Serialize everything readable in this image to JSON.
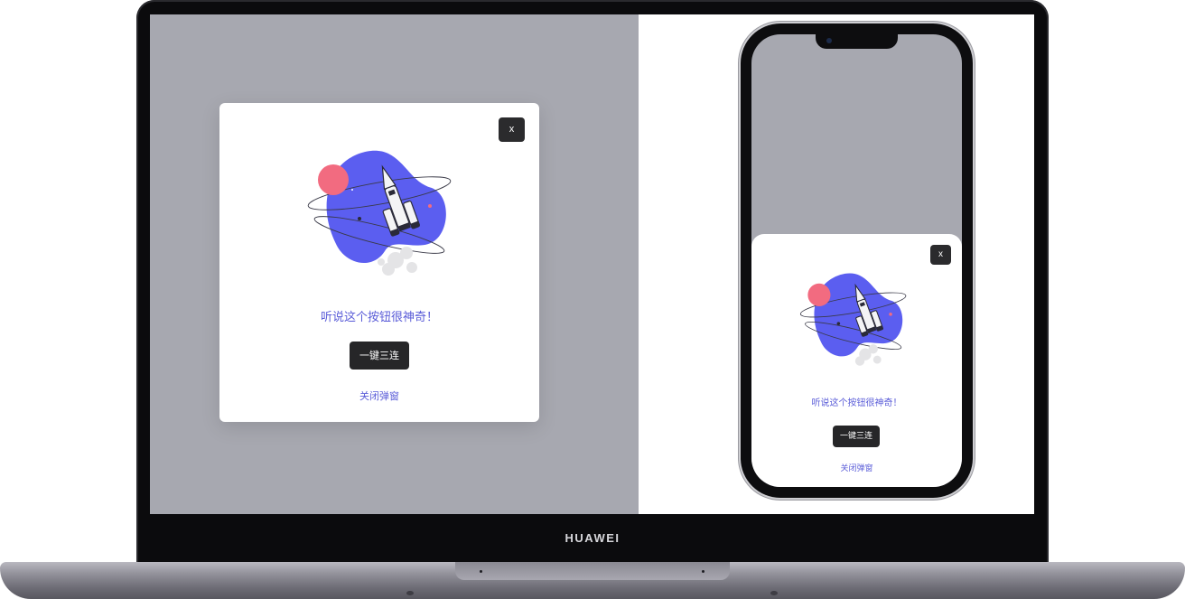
{
  "brand": "HUAWEI",
  "desktop_modal": {
    "close_label": "x",
    "title": "听说这个按钮很神奇！",
    "primary_label": "一键三连",
    "dismiss_label": "关闭弹窗"
  },
  "mobile_modal": {
    "close_label": "x",
    "title": "听说这个按钮很神奇！",
    "primary_label": "一键三连",
    "dismiss_label": "关闭弹窗"
  },
  "colors": {
    "overlay": "#a7a8b0",
    "accent": "#5a5cd8",
    "button": "#262628",
    "blob": "#5b5ef0",
    "planet": "#f26b80"
  },
  "icons": [
    "close-icon",
    "rocket-illustration"
  ]
}
